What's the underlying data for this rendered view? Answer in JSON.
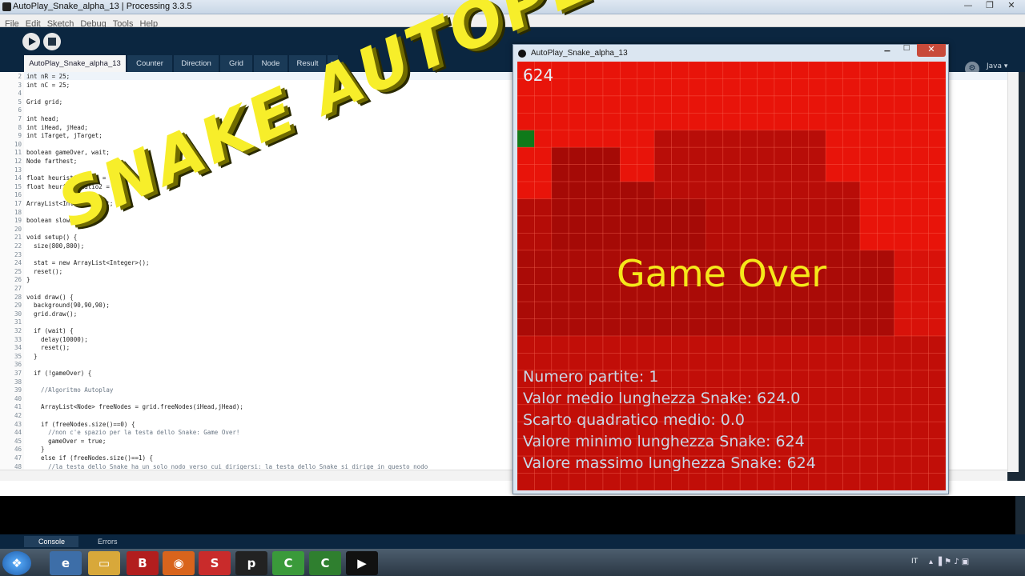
{
  "window": {
    "title": "AutoPlay_Snake_alpha_13 | Processing 3.3.5"
  },
  "menu": [
    "File",
    "Edit",
    "Sketch",
    "Debug",
    "Tools",
    "Help"
  ],
  "tabs": [
    "AutoPlay_Snake_alpha_13",
    "Counter",
    "Direction",
    "Grid",
    "Node",
    "Result",
    "▾"
  ],
  "mode": "Java ▾",
  "editor": {
    "lines": [
      {
        "n": "2",
        "t": "int nR = 25;"
      },
      {
        "n": "3",
        "t": "int nC = 25;"
      },
      {
        "n": "4",
        "t": ""
      },
      {
        "n": "5",
        "t": "Grid grid;"
      },
      {
        "n": "6",
        "t": ""
      },
      {
        "n": "7",
        "t": "int head;"
      },
      {
        "n": "8",
        "t": "int iHead, jHead;"
      },
      {
        "n": "9",
        "t": "int iTarget, jTarget;"
      },
      {
        "n": "10",
        "t": ""
      },
      {
        "n": "11",
        "t": "boolean gameOver, wait;"
      },
      {
        "n": "12",
        "t": "Node farthest;"
      },
      {
        "n": "13",
        "t": ""
      },
      {
        "n": "14",
        "t": "float heuristicRatio = 2;"
      },
      {
        "n": "15",
        "t": "float heuristicRatio2 = 75;"
      },
      {
        "n": "16",
        "t": ""
      },
      {
        "n": "17",
        "t": "ArrayList<Integer> stat;"
      },
      {
        "n": "18",
        "t": ""
      },
      {
        "n": "19",
        "t": "boolean slowMotion;"
      },
      {
        "n": "20",
        "t": ""
      },
      {
        "n": "21",
        "t": "void setup() {"
      },
      {
        "n": "22",
        "t": "  size(800,800);"
      },
      {
        "n": "23",
        "t": ""
      },
      {
        "n": "24",
        "t": "  stat = new ArrayList<Integer>();"
      },
      {
        "n": "25",
        "t": "  reset();"
      },
      {
        "n": "26",
        "t": "}"
      },
      {
        "n": "27",
        "t": ""
      },
      {
        "n": "28",
        "t": "void draw() {"
      },
      {
        "n": "29",
        "t": "  background(90,90,90);"
      },
      {
        "n": "30",
        "t": "  grid.draw();"
      },
      {
        "n": "31",
        "t": ""
      },
      {
        "n": "32",
        "t": "  if (wait) {"
      },
      {
        "n": "33",
        "t": "    delay(10000);"
      },
      {
        "n": "34",
        "t": "    reset();"
      },
      {
        "n": "35",
        "t": "  }"
      },
      {
        "n": "36",
        "t": ""
      },
      {
        "n": "37",
        "t": "  if (!gameOver) {"
      },
      {
        "n": "38",
        "t": ""
      },
      {
        "n": "39",
        "t": "    //Algoritmo Autoplay"
      },
      {
        "n": "40",
        "t": ""
      },
      {
        "n": "41",
        "t": "    ArrayList<Node> freeNodes = grid.freeNodes(iHead,jHead);"
      },
      {
        "n": "42",
        "t": ""
      },
      {
        "n": "43",
        "t": "    if (freeNodes.size()==0) {"
      },
      {
        "n": "44",
        "t": "      //non c'e spazio per la testa dello Snake: Game Over!"
      },
      {
        "n": "45",
        "t": "      gameOver = true;"
      },
      {
        "n": "46",
        "t": "    }"
      },
      {
        "n": "47",
        "t": "    else if (freeNodes.size()==1) {"
      },
      {
        "n": "48",
        "t": "      //la testa dello Snake ha un solo nodo verso cui dirigersi: la testa dello Snake si dirige in questo nodo"
      }
    ]
  },
  "console": {
    "tabs": [
      "Console",
      "Errors"
    ]
  },
  "sketch": {
    "title": "AutoPlay_Snake_alpha_13",
    "score": "624",
    "game_over": "Game Over",
    "stats": [
      "Numero partite: 1",
      "Valor medio lunghezza Snake: 624.0",
      "Scarto quadratico medio: 0.0",
      "Valore minimo lunghezza Snake: 624",
      "Valore massimo lunghezza Snake: 624"
    ]
  },
  "overlay": {
    "text": "SNAKE AUTOPLAY IN JAVA"
  },
  "taskbar": {
    "lang": "IT"
  },
  "colors": {
    "canvas_red": "#e8140a",
    "game_over": "#f5e81a",
    "overlay": "#f7ee2a",
    "snake_head": "#1a8a1a"
  }
}
